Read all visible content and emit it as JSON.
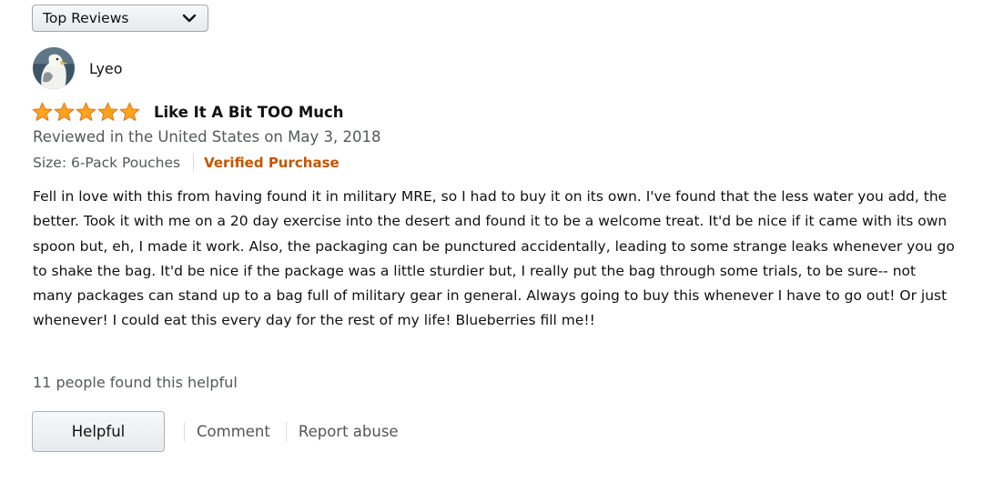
{
  "sort": {
    "selected": "Top Reviews",
    "icon": "chevron-down-icon"
  },
  "reviewer": {
    "name": "Lyeo",
    "avatar_icon": "seagull-avatar"
  },
  "review": {
    "rating": 5,
    "rating_max": 5,
    "star_color": "#ffa41c",
    "title": "Like It A Bit TOO Much",
    "reviewed_line": "Reviewed in the United States on May 3, 2018",
    "size": "Size: 6-Pack Pouches",
    "verified": "Verified Purchase",
    "verified_color": "#c45500",
    "body": "Fell in love with this from having found it in military MRE, so I had to buy it on its own. I've found that the less water you add, the better. Took it with me on a 20 day exercise into the desert and found it to be a welcome treat. It'd be nice if it came with its own spoon but, eh, I made it work. Also, the packaging can be punctured accidentally, leading to some strange leaks whenever you go to shake the bag. It'd be nice if the package was a little sturdier but, I really put the bag through some trials, to be sure-- not many packages can stand up to a bag full of military gear in general. Always going to buy this whenever I have to go out! Or just whenever! I could eat this every day for the rest of my life! Blueberries fill me!!",
    "helpful_count": "11 people found this helpful"
  },
  "actions": {
    "helpful": "Helpful",
    "comment": "Comment",
    "report": "Report abuse"
  }
}
